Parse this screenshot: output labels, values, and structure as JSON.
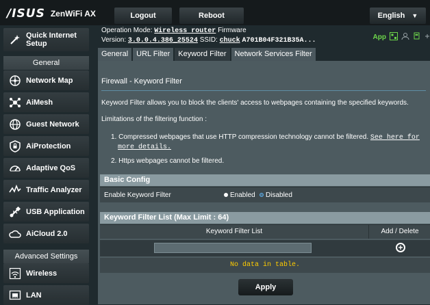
{
  "header": {
    "brand": "/ISUS",
    "model": "ZenWiFi AX",
    "logout_label": "Logout",
    "reboot_label": "Reboot",
    "language": "English"
  },
  "status": {
    "operation_mode_label": "Operation Mode:",
    "operation_mode": "Wireless router",
    "firmware_label": "Firmware",
    "version_label": "Version:",
    "version": "3.0.0.4.386_25524",
    "ssid_label": "SSID:",
    "ssid_1": "chuck",
    "ssid_2": "A701B04F321B35A...",
    "app_label": "App"
  },
  "tabs": [
    {
      "label": "General"
    },
    {
      "label": "URL Filter"
    },
    {
      "label": "Keyword Filter"
    },
    {
      "label": "Network Services Filter"
    }
  ],
  "sidebar": {
    "quick_setup": "Quick Internet Setup",
    "general_header": "General",
    "items": [
      {
        "label": "Network Map",
        "icon": "network-map-icon"
      },
      {
        "label": "AiMesh",
        "icon": "aimesh-icon"
      },
      {
        "label": "Guest Network",
        "icon": "guest-network-icon"
      },
      {
        "label": "AiProtection",
        "icon": "shield-lock-icon"
      },
      {
        "label": "Adaptive QoS",
        "icon": "gauge-icon"
      },
      {
        "label": "Traffic Analyzer",
        "icon": "traffic-analyzer-icon"
      },
      {
        "label": "USB Application",
        "icon": "usb-icon"
      },
      {
        "label": "AiCloud 2.0",
        "icon": "cloud-icon"
      }
    ],
    "advanced_header": "Advanced Settings",
    "advanced_items": [
      {
        "label": "Wireless",
        "icon": "wifi-icon"
      },
      {
        "label": "LAN",
        "icon": "lan-icon"
      }
    ]
  },
  "content": {
    "title": "Firewall - Keyword Filter",
    "description": "Keyword Filter allows you to block the clients' access to webpages containing the specified keywords.",
    "limitations_title": "Limitations of the filtering function :",
    "limitation_1": "1. Compressed webpages that use HTTP compression technology cannot be filtered.",
    "limitation_1_link": "See here for",
    "limitation_1_link_2": "more details.",
    "limitation_2": "2. Https webpages cannot be filtered.",
    "basic_config_title": "Basic Config",
    "enable_label": "Enable Keyword Filter",
    "enabled_option": "Enabled",
    "disabled_option": "Disabled",
    "selected_option": "Disabled",
    "list_title": "Keyword Filter List (Max Limit : 64)",
    "col_keyword": "Keyword Filter List",
    "col_add_delete": "Add / Delete",
    "keyword_input_value": "",
    "no_data": "No data in table.",
    "apply_label": "Apply"
  },
  "colors": {
    "accent_blue": "#5aa9e6",
    "no_data_yellow": "#ffcc00",
    "app_green": "#6dd64a"
  }
}
